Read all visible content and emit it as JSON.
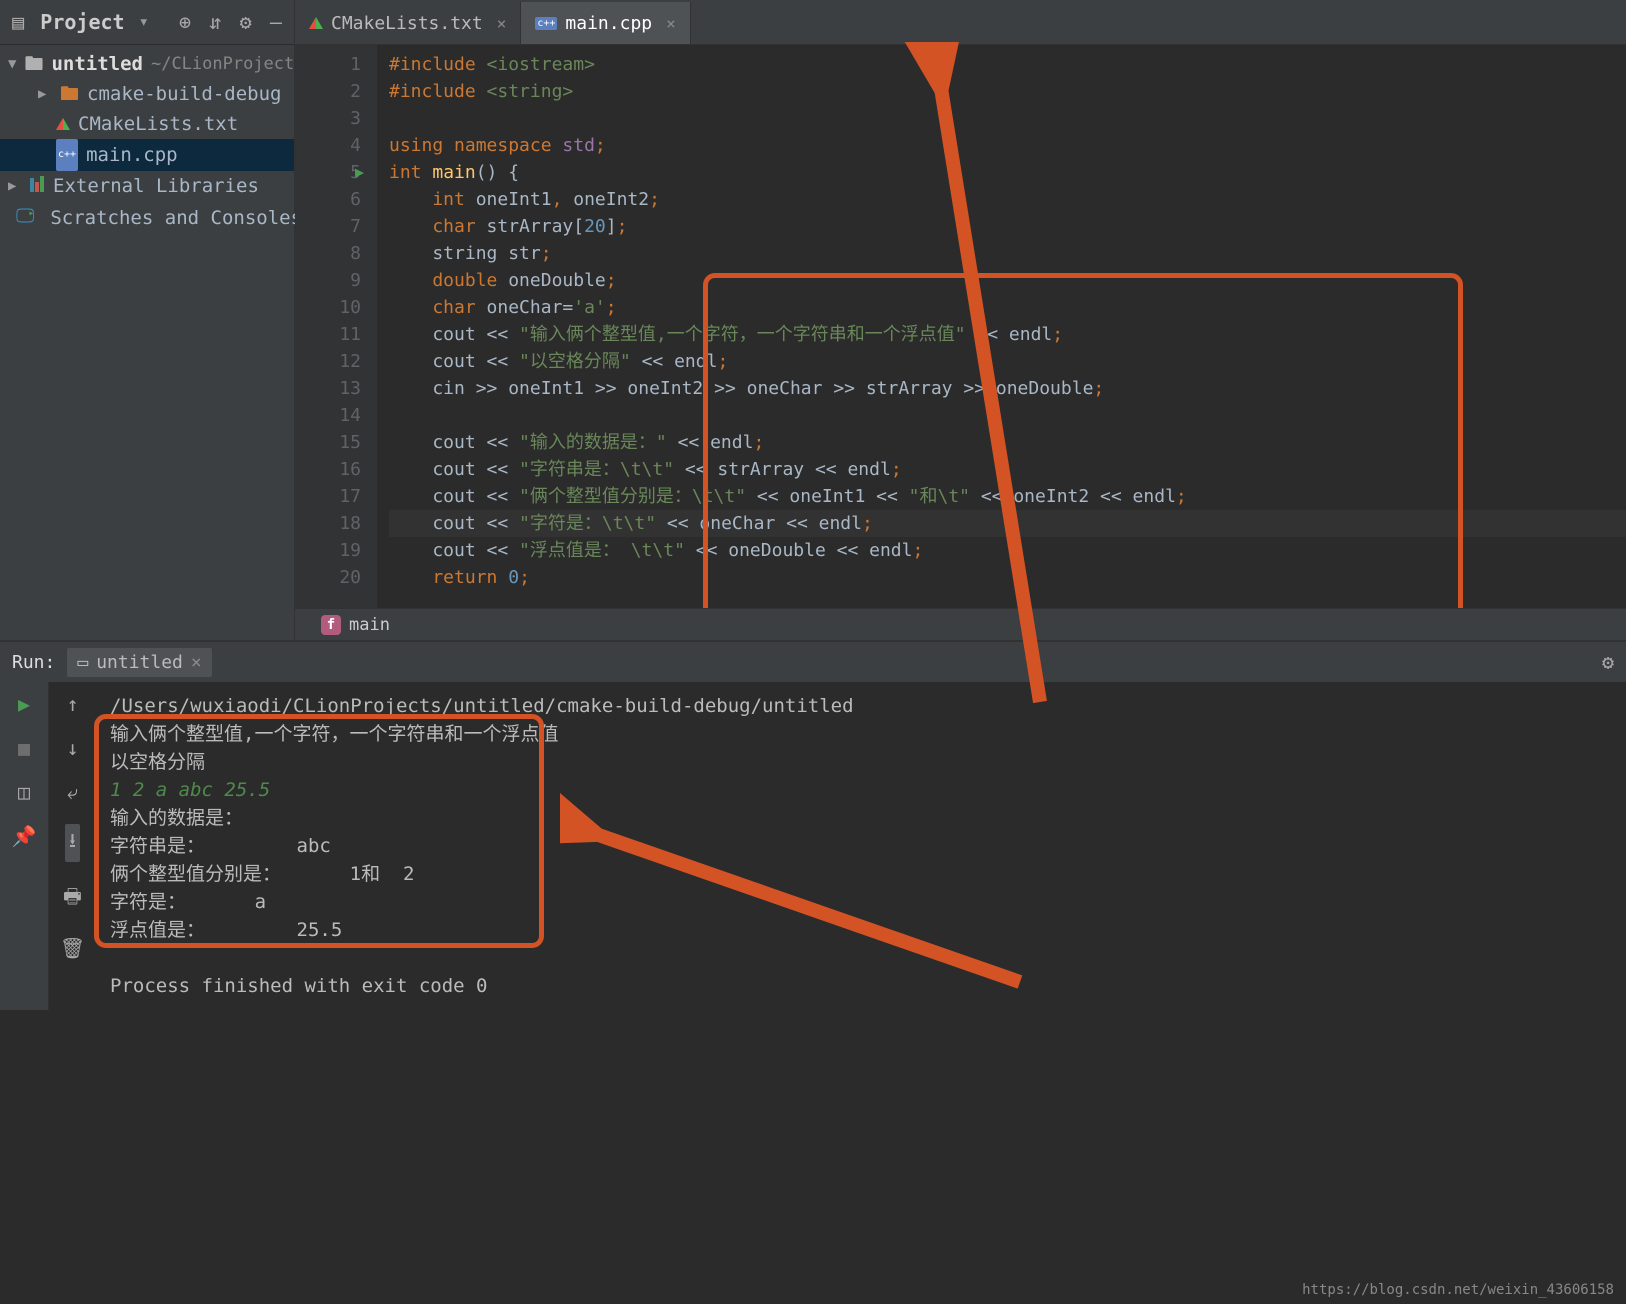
{
  "sidebar": {
    "toolbar_label": "Project",
    "project_name": "untitled",
    "project_path": "~/CLionProjects",
    "items": [
      {
        "label": "cmake-build-debug"
      },
      {
        "label": "CMakeLists.txt"
      },
      {
        "label": "main.cpp"
      }
    ],
    "external_libraries": "External Libraries",
    "scratches": "Scratches and Consoles"
  },
  "tabs": [
    {
      "label": "CMakeLists.txt",
      "active": false
    },
    {
      "label": "main.cpp",
      "active": true
    }
  ],
  "code": {
    "lines": [
      [
        {
          "t": "#include ",
          "c": "orange"
        },
        {
          "t": "<iostream>",
          "c": "green"
        }
      ],
      [
        {
          "t": "#include ",
          "c": "orange"
        },
        {
          "t": "<string>",
          "c": "green"
        }
      ],
      [],
      [
        {
          "t": "using namespace ",
          "c": "orange"
        },
        {
          "t": "std",
          "c": "purple"
        },
        {
          "t": ";",
          "c": "orange"
        }
      ],
      [
        {
          "t": "int ",
          "c": "orange"
        },
        {
          "t": "main",
          "c": "yellow"
        },
        {
          "t": "() {",
          "c": ""
        }
      ],
      [
        {
          "t": "    int ",
          "c": "orange"
        },
        {
          "t": "oneInt1",
          "c": ""
        },
        {
          "t": ", ",
          "c": "orange"
        },
        {
          "t": "oneInt2",
          "c": ""
        },
        {
          "t": ";",
          "c": "orange"
        }
      ],
      [
        {
          "t": "    char ",
          "c": "orange"
        },
        {
          "t": "strArray[",
          "c": ""
        },
        {
          "t": "20",
          "c": "blue"
        },
        {
          "t": "]",
          "c": ""
        },
        {
          "t": ";",
          "c": "orange"
        }
      ],
      [
        {
          "t": "    string str",
          "c": ""
        },
        {
          "t": ";",
          "c": "orange"
        }
      ],
      [
        {
          "t": "    double ",
          "c": "orange"
        },
        {
          "t": "oneDouble",
          "c": ""
        },
        {
          "t": ";",
          "c": "orange"
        }
      ],
      [
        {
          "t": "    char ",
          "c": "orange"
        },
        {
          "t": "oneChar=",
          "c": ""
        },
        {
          "t": "'a'",
          "c": "green"
        },
        {
          "t": ";",
          "c": "orange"
        }
      ],
      [
        {
          "t": "    cout << ",
          "c": ""
        },
        {
          "t": "\"输入俩个整型值,一个字符，一个字符串和一个浮点值\"",
          "c": "green"
        },
        {
          "t": " << endl",
          "c": ""
        },
        {
          "t": ";",
          "c": "orange"
        }
      ],
      [
        {
          "t": "    cout << ",
          "c": ""
        },
        {
          "t": "\"以空格分隔\"",
          "c": "green"
        },
        {
          "t": " << endl",
          "c": ""
        },
        {
          "t": ";",
          "c": "orange"
        }
      ],
      [
        {
          "t": "    cin >> oneInt1 >> oneInt2 >> oneChar >> strArray >> oneDouble",
          "c": ""
        },
        {
          "t": ";",
          "c": "orange"
        }
      ],
      [],
      [
        {
          "t": "    cout << ",
          "c": ""
        },
        {
          "t": "\"输入的数据是：\"",
          "c": "green"
        },
        {
          "t": " << endl",
          "c": ""
        },
        {
          "t": ";",
          "c": "orange"
        }
      ],
      [
        {
          "t": "    cout << ",
          "c": ""
        },
        {
          "t": "\"字符串是：\\t\\t\"",
          "c": "green"
        },
        {
          "t": " << strArray << endl",
          "c": ""
        },
        {
          "t": ";",
          "c": "orange"
        }
      ],
      [
        {
          "t": "    cout << ",
          "c": ""
        },
        {
          "t": "\"俩个整型值分别是：\\t\\t\"",
          "c": "green"
        },
        {
          "t": " << oneInt1 << ",
          "c": ""
        },
        {
          "t": "\"和\\t\"",
          "c": "green"
        },
        {
          "t": " << oneInt2 << endl",
          "c": ""
        },
        {
          "t": ";",
          "c": "orange"
        }
      ],
      [
        {
          "t": "    cout << ",
          "c": ""
        },
        {
          "t": "\"字符是：\\t\\t\"",
          "c": "green"
        },
        {
          "t": " << oneChar << endl",
          "c": ""
        },
        {
          "t": ";",
          "c": "orange"
        }
      ],
      [
        {
          "t": "    cout << ",
          "c": ""
        },
        {
          "t": "\"浮点值是： \\t\\t\"",
          "c": "green"
        },
        {
          "t": " << oneDouble << endl",
          "c": ""
        },
        {
          "t": ";",
          "c": "orange"
        }
      ],
      [
        {
          "t": "    return ",
          "c": "orange"
        },
        {
          "t": "0",
          "c": "blue"
        },
        {
          "t": ";",
          "c": "orange"
        }
      ]
    ],
    "current_line": 18,
    "start_line": 1
  },
  "breadcrumb": "main",
  "run": {
    "panel_label": "Run:",
    "tab_label": "untitled",
    "exec_path": "/Users/wuxiaodi/CLionProjects/untitled/cmake-build-debug/untitled",
    "output": [
      {
        "t": "输入俩个整型值,一个字符，一个字符串和一个浮点值"
      },
      {
        "t": "以空格分隔"
      },
      {
        "t": "1 2 a abc 25.5",
        "input": true
      },
      {
        "t": "输入的数据是："
      },
      {
        "t": "字符串是：        abc"
      },
      {
        "t": "俩个整型值分别是：      1和  2"
      },
      {
        "t": "字符是：      a"
      },
      {
        "t": "浮点值是：        25.5"
      }
    ],
    "exit_msg": "Process finished with exit code 0"
  },
  "watermark": "https://blog.csdn.net/weixin_43606158"
}
